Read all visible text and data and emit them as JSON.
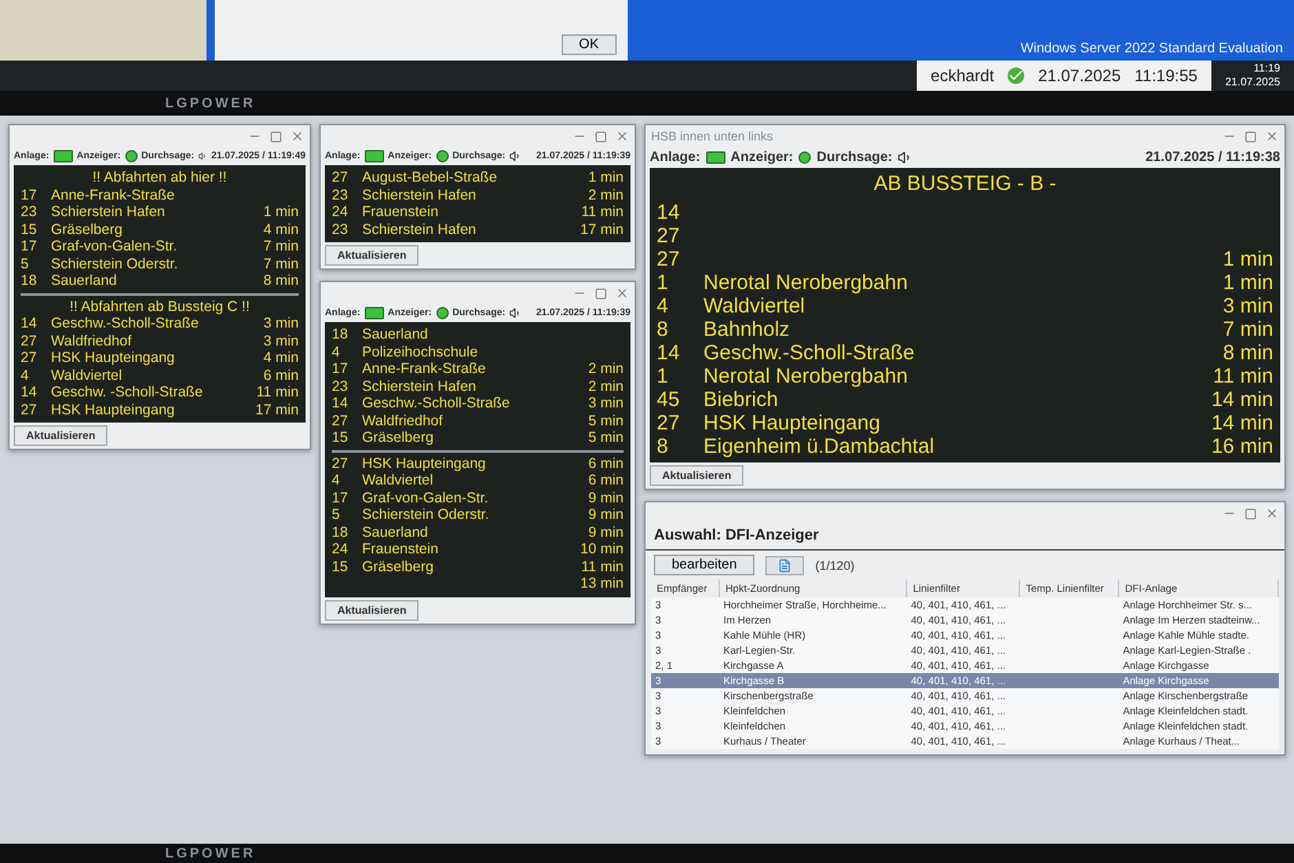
{
  "top_monitor": {
    "dialog": {
      "button": "OK"
    },
    "watermark": "Windows Server 2022 Standard Evaluation",
    "status": {
      "user": "eckhardt",
      "online": true,
      "date": "21.07.2025",
      "time": "11:19:55"
    },
    "clock": {
      "time": "11:19",
      "date": "21.07.2025"
    },
    "brand": "LGPOWER"
  },
  "boards": [
    {
      "kind": "compact",
      "labels": {
        "anlage": "Anlage:",
        "anzeiger": "Anzeiger:",
        "durchsage": "Durchsage:"
      },
      "anlage_ok": true,
      "anzeiger_ok": true,
      "timestamp": "21.07.2025 / 11:19:49",
      "button": "Aktualisieren",
      "sections": [
        {
          "heading": "!!  Abfahrten ab hier  !!",
          "rows": [
            {
              "line": "17",
              "destination": "Anne-Frank-Straße"
            },
            {
              "line": "23",
              "destination": "Schierstein Hafen",
              "time": "1 min"
            },
            {
              "line": "15",
              "destination": "Gräselberg",
              "time": "4 min"
            },
            {
              "line": "17",
              "destination": "Graf-von-Galen-Str.",
              "time": "7 min"
            },
            {
              "line": "5",
              "destination": "Schierstein Oderstr.",
              "time": "7 min"
            },
            {
              "line": "18",
              "destination": "Sauerland",
              "time": "8 min"
            }
          ]
        },
        {
          "heading": "!!  Abfahrten ab Bussteig C  !!",
          "rows": [
            {
              "line": "14",
              "destination": "Geschw.-Scholl-Straße",
              "time": "3 min"
            },
            {
              "line": "27",
              "destination": "Waldfriedhof",
              "time": "3 min"
            },
            {
              "line": "27",
              "destination": "HSK Haupteingang",
              "time": "4 min"
            },
            {
              "line": "4",
              "destination": "Waldviertel",
              "time": "6 min"
            },
            {
              "line": "14",
              "destination": "Geschw. -Scholl-Straße",
              "time": "11 min"
            },
            {
              "line": "27",
              "destination": "HSK Haupteingang",
              "time": "17 min"
            }
          ]
        }
      ]
    },
    {
      "kind": "compact",
      "labels": {
        "anlage": "Anlage:",
        "anzeiger": "Anzeiger:",
        "durchsage": "Durchsage:"
      },
      "anlage_ok": true,
      "anzeiger_ok": true,
      "timestamp": "21.07.2025 / 11:19:39",
      "button": "Aktualisieren",
      "sections": [
        {
          "rows": [
            {
              "line": "27",
              "destination": "August-Bebel-Straße",
              "time": "1 min"
            },
            {
              "line": "23",
              "destination": "Schierstein Hafen",
              "time": "2 min"
            },
            {
              "line": "24",
              "destination": "Frauenstein",
              "time": "11 min"
            },
            {
              "line": "23",
              "destination": "Schierstein Hafen",
              "time": "17 min"
            }
          ]
        }
      ]
    },
    {
      "kind": "compact",
      "labels": {
        "anlage": "Anlage:",
        "anzeiger": "Anzeiger:",
        "durchsage": "Durchsage:"
      },
      "anlage_ok": true,
      "anzeiger_ok": true,
      "timestamp": "21.07.2025 / 11:19:39",
      "button": "Aktualisieren",
      "sections": [
        {
          "rows": [
            {
              "line": "18",
              "destination": "Sauerland"
            },
            {
              "line": "4",
              "destination": "Polizeihochschule"
            },
            {
              "line": "17",
              "destination": "Anne-Frank-Straße",
              "time": "2 min"
            },
            {
              "line": "23",
              "destination": "Schierstein Hafen",
              "time": "2 min"
            },
            {
              "line": "14",
              "destination": "Geschw.-Scholl-Straße",
              "time": "3 min"
            },
            {
              "line": "27",
              "destination": "Waldfriedhof",
              "time": "5 min"
            },
            {
              "line": "15",
              "destination": "Gräselberg",
              "time": "5 min"
            }
          ]
        },
        {
          "rows": [
            {
              "line": "27",
              "destination": "HSK Haupteingang",
              "time": "6 min"
            },
            {
              "line": "4",
              "destination": "Waldviertel",
              "time": "6 min"
            },
            {
              "line": "17",
              "destination": "Graf-von-Galen-Str.",
              "time": "9 min"
            },
            {
              "line": "5",
              "destination": "Schierstein Oderstr.",
              "time": "9 min"
            },
            {
              "line": "18",
              "destination": "Sauerland",
              "time": "9 min"
            },
            {
              "line": "24",
              "destination": "Frauenstein",
              "time": "10 min"
            },
            {
              "line": "15",
              "destination": "Gräselberg",
              "time": "11 min"
            },
            {
              "time": "13 min"
            }
          ]
        }
      ]
    },
    {
      "kind": "large",
      "title": "HSB innen unten links",
      "labels": {
        "anlage": "Anlage:",
        "anzeiger": "Anzeiger:",
        "durchsage": "Durchsage:"
      },
      "anlage_ok": true,
      "anzeiger_ok": true,
      "timestamp": "21.07.2025 / 11:19:38",
      "button": "Aktualisieren",
      "sections": [
        {
          "heading": "AB BUSSTEIG  - B -",
          "rows": [
            {
              "line": "14"
            },
            {
              "line": "27"
            },
            {
              "line": "27",
              "time": "1 min"
            },
            {
              "line": "1",
              "destination": "Nerotal Nerobergbahn",
              "time": "1 min"
            },
            {
              "line": "4",
              "destination": "Waldviertel",
              "time": "3 min"
            },
            {
              "line": "8",
              "destination": "Bahnholz",
              "time": "7 min"
            },
            {
              "line": "14",
              "destination": "Geschw.-Scholl-Straße",
              "time": "8 min"
            },
            {
              "line": "1",
              "destination": "Nerotal Nerobergbahn",
              "time": "11 min"
            },
            {
              "line": "45",
              "destination": "Biebrich",
              "time": "14 min"
            },
            {
              "line": "27",
              "destination": "HSK Haupteingang",
              "time": "14 min"
            },
            {
              "line": "8",
              "destination": "Eigenheim ü.Dambachtal",
              "time": "16 min"
            }
          ]
        }
      ]
    }
  ],
  "dfi_window": {
    "title": "Auswahl: DFI-Anzeiger",
    "edit_button": "bearbeiten",
    "count": "(1/120)",
    "columns": [
      "Empfänger",
      "Hpkt-Zuordnung",
      "Linienfilter",
      "Temp. Linienfilter",
      "DFI-Anlage"
    ],
    "rows": [
      {
        "cells": [
          "3",
          "Horchheimer Straße, Horchheime...",
          "40, 401, 410, 461, ...",
          "",
          "Anlage Horchheimer Str. s..."
        ],
        "selected": false
      },
      {
        "cells": [
          "3",
          "Im Herzen",
          "40, 401, 410, 461, ...",
          "",
          "Anlage Im Herzen stadteinw..."
        ],
        "selected": false
      },
      {
        "cells": [
          "3",
          "Kahle Mühle (HR)",
          "40, 401, 410, 461, ...",
          "",
          "Anlage Kahle Mühle stadte."
        ],
        "selected": false
      },
      {
        "cells": [
          "3",
          "Karl-Legien-Str.",
          "40, 401, 410, 461, ...",
          "",
          "Anlage Karl-Legien-Straße ."
        ],
        "selected": false
      },
      {
        "cells": [
          "2, 1",
          "Kirchgasse A",
          "40, 401, 410, 461, ...",
          "",
          "Anlage Kirchgasse"
        ],
        "selected": false
      },
      {
        "cells": [
          "3",
          "Kirchgasse B",
          "40, 401, 410, 461, ...",
          "",
          "Anlage Kirchgasse"
        ],
        "selected": true
      },
      {
        "cells": [
          "3",
          "Kirschenbergstraße",
          "40, 401, 410, 461, ...",
          "",
          "Anlage Kirschenbergstraße"
        ],
        "selected": false
      },
      {
        "cells": [
          "3",
          "Kleinfeldchen",
          "40, 401, 410, 461, ...",
          "",
          "Anlage Kleinfeldchen stadt."
        ],
        "selected": false
      },
      {
        "cells": [
          "3",
          "Kleinfeldchen",
          "40, 401, 410, 461, ...",
          "",
          "Anlage Kleinfeldchen stadt."
        ],
        "selected": false
      },
      {
        "cells": [
          "3",
          "Kurhaus / Theater",
          "40, 401, 410, 461, ...",
          "",
          "Anlage Kurhaus / Theat..."
        ],
        "selected": false
      }
    ]
  },
  "bottom_brand": "LGPOWER"
}
